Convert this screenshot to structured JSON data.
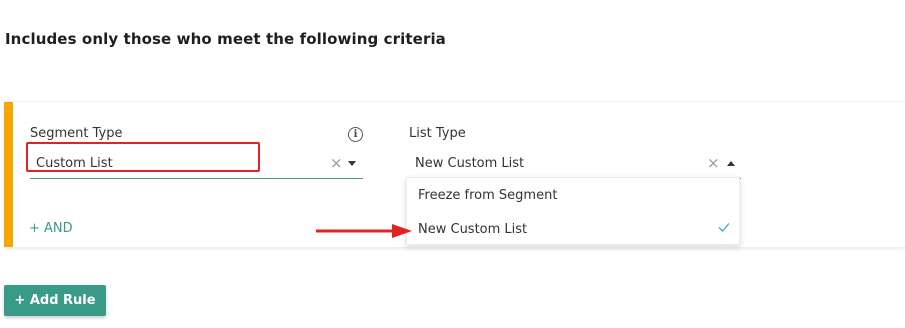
{
  "heading": "Includes only those who meet the following criteria",
  "rule": {
    "segment_type": {
      "label": "Segment Type",
      "value": "Custom List",
      "info_icon": "info-icon",
      "clear_icon": "×"
    },
    "list_type": {
      "label": "List Type",
      "value": "New Custom List",
      "clear_icon": "×",
      "options": [
        {
          "label": "Freeze from Segment",
          "selected": false
        },
        {
          "label": "New Custom List",
          "selected": true
        }
      ]
    },
    "and_label": "+ AND"
  },
  "add_rule_label": "+ Add Rule",
  "colors": {
    "accent": "#f5a700",
    "teal": "#3a9a88",
    "annotation_red": "#e02424"
  }
}
